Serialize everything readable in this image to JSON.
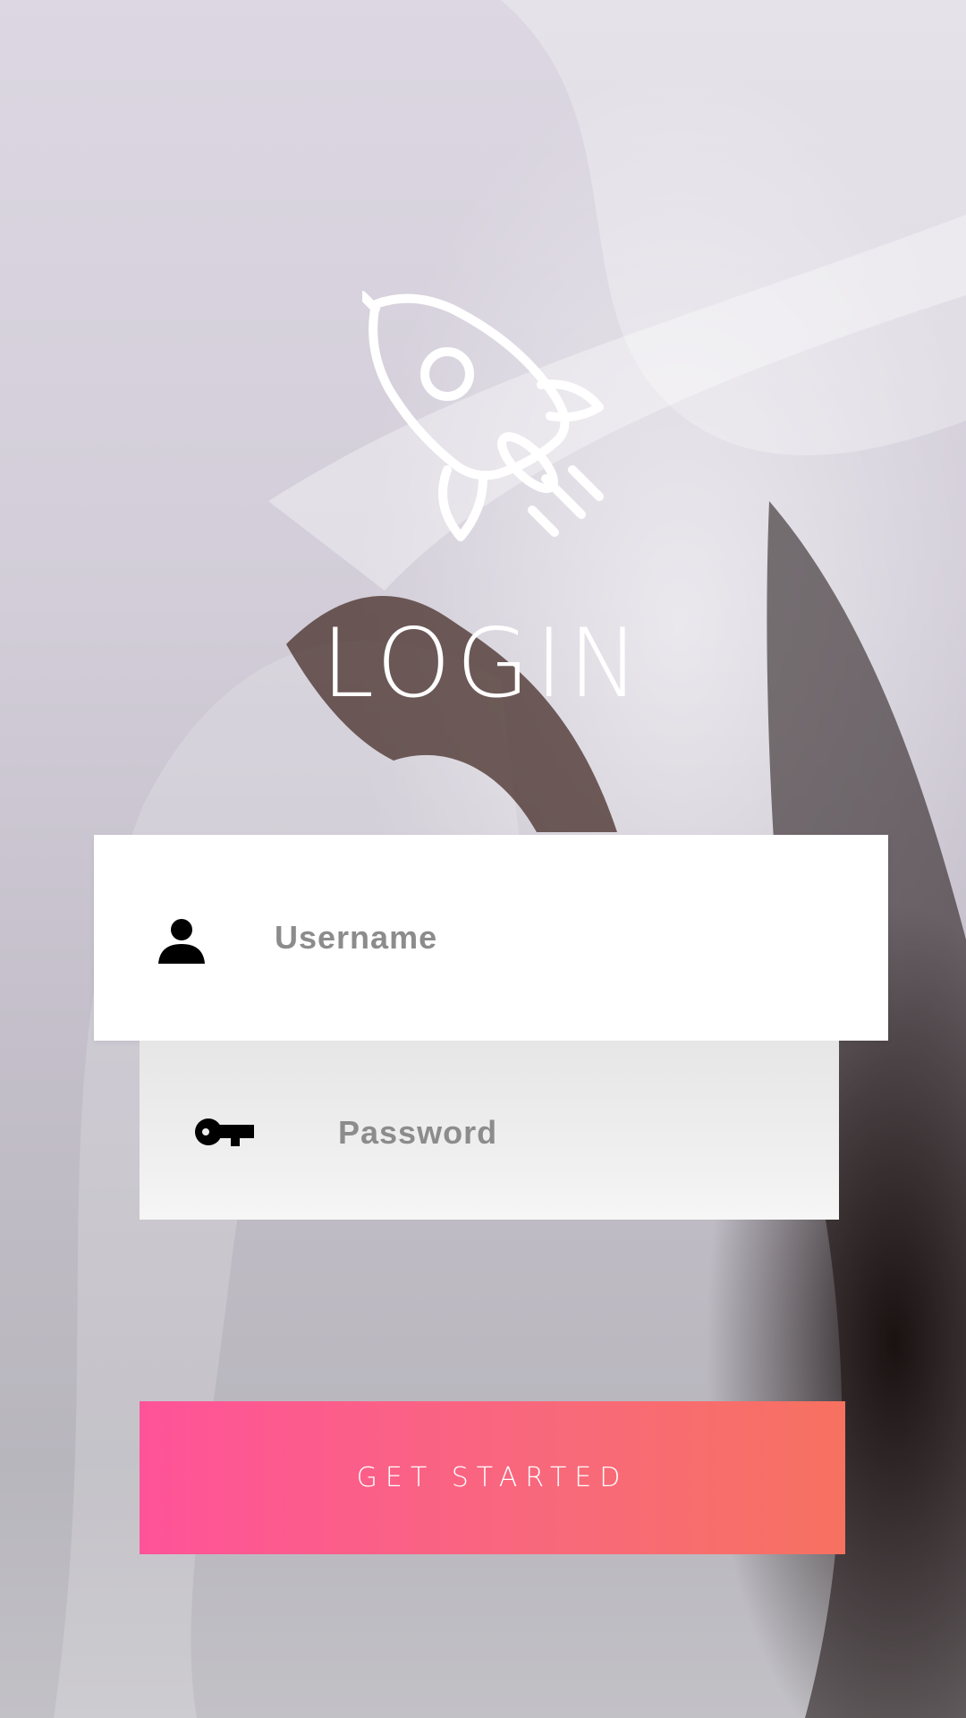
{
  "screen": {
    "title": "LOGIN"
  },
  "login_form": {
    "username_placeholder": "Username",
    "password_placeholder": "Password",
    "submit_label": "GET STARTED"
  },
  "icons": {
    "logo": "rocket-icon",
    "username": "user-icon",
    "password": "key-icon"
  },
  "colors": {
    "button_gradient_start": "#ff5399",
    "button_gradient_end": "#f77160",
    "title": "#ffffff",
    "placeholder": "#8c8c8c"
  }
}
